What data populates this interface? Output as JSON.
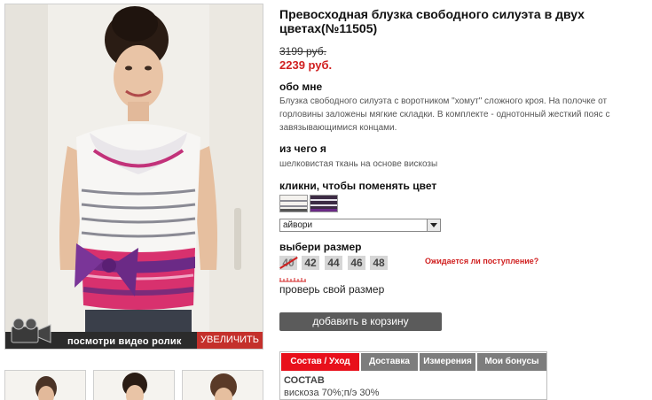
{
  "product": {
    "title": "Превосходная блузка свободного силуэта в двух цветах(№11505)",
    "old_price": "3199 руб.",
    "new_price": "2239 руб."
  },
  "gallery": {
    "video_label": "посмотри видео ролик",
    "zoom_label": "УВЕЛИЧИТЬ",
    "thumbnails_count_visible": 3
  },
  "about": {
    "heading": "обо мне",
    "text": "Блузка свободного силуэта с воротником \"хомут\" сложного кроя. На полочке от горловины заложены мягкие складки. В комплекте - однотонный жесткий пояс с завязывающимися концами."
  },
  "material": {
    "heading": "из чего я",
    "text": "шелковистая ткань на основе вискозы"
  },
  "color": {
    "heading": "кликни, чтобы поменять цвет",
    "selected": "айвори",
    "swatches": [
      "айвори",
      "фиолетовый"
    ]
  },
  "size": {
    "heading": "выбери размер",
    "options": [
      {
        "label": "40",
        "available": false
      },
      {
        "label": "42",
        "available": true
      },
      {
        "label": "44",
        "available": true
      },
      {
        "label": "46",
        "available": true
      },
      {
        "label": "48",
        "available": true
      }
    ],
    "awaiting_link": "Ожидается ли поступление?",
    "check_size_link": "проверь свой размер"
  },
  "cart": {
    "button_label": "добавить в корзину"
  },
  "info_tabs": {
    "tabs": [
      "Состав / Уход",
      "Доставка",
      "Измерения",
      "Мои бонусы"
    ],
    "active_index": 0,
    "content_title": "СОСТАВ",
    "content_text": "вискоза 70%;п/э 30%"
  },
  "colors": {
    "price_red": "#d01f1f",
    "active_tab": "#e8101b",
    "inactive_tab": "#7d7d7d",
    "button": "#5b5b5b"
  }
}
